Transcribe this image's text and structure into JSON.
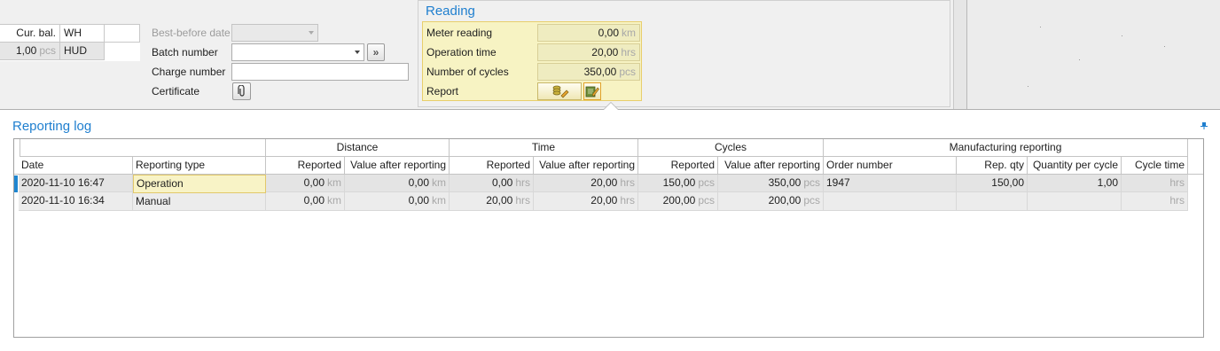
{
  "top_grid": {
    "headers": [
      "Cur. bal.",
      "WH"
    ],
    "row": {
      "cur_bal": "1,00",
      "cur_bal_unit": "pcs",
      "wh": "HUD"
    }
  },
  "form": {
    "best_before_label": "Best-before date",
    "batch_number_label": "Batch number",
    "charge_number_label": "Charge number",
    "certificate_label": "Certificate",
    "batch_number_value": "",
    "charge_number_value": ""
  },
  "reading": {
    "title": "Reading",
    "meter_label": "Meter reading",
    "meter_value": "0,00",
    "meter_unit": "km",
    "operation_label": "Operation time",
    "operation_value": "20,00",
    "operation_unit": "hrs",
    "cycles_label": "Number of cycles",
    "cycles_value": "350,00",
    "cycles_unit": "pcs",
    "report_label": "Report"
  },
  "log": {
    "title": "Reporting log",
    "bands": {
      "distance": "Distance",
      "time": "Time",
      "cycles": "Cycles",
      "manufacturing": "Manufacturing reporting"
    },
    "columns": {
      "date": "Date",
      "type": "Reporting type",
      "dist_rep": "Reported",
      "dist_after": "Value after reporting",
      "time_rep": "Reported",
      "time_after": "Value after reporting",
      "cyc_rep": "Reported",
      "cyc_after": "Value after reporting",
      "order": "Order number",
      "rep_qty": "Rep. qty",
      "qty_cycle": "Quantity per cycle",
      "cycle_time": "Cycle time"
    },
    "rows": [
      {
        "date": "2020-11-10 16:47",
        "type": "Operation",
        "dist_rep": "0,00",
        "dist_rep_u": "km",
        "dist_after": "0,00",
        "dist_after_u": "km",
        "time_rep": "0,00",
        "time_rep_u": "hrs",
        "time_after": "20,00",
        "time_after_u": "hrs",
        "cyc_rep": "150,00",
        "cyc_rep_u": "pcs",
        "cyc_after": "350,00",
        "cyc_after_u": "pcs",
        "order": "1947",
        "rep_qty": "150,00",
        "qty_cycle": "1,00",
        "cycle_time_u": "hrs"
      },
      {
        "date": "2020-11-10 16:34",
        "type": "Manual",
        "dist_rep": "0,00",
        "dist_rep_u": "km",
        "dist_after": "0,00",
        "dist_after_u": "km",
        "time_rep": "20,00",
        "time_rep_u": "hrs",
        "time_after": "20,00",
        "time_after_u": "hrs",
        "cyc_rep": "200,00",
        "cyc_rep_u": "pcs",
        "cyc_after": "200,00",
        "cyc_after_u": "pcs",
        "order": "",
        "rep_qty": "",
        "qty_cycle": "",
        "cycle_time_u": "hrs"
      }
    ]
  },
  "colors": {
    "accent": "#1f7fcf",
    "highlight": "#f7f3c3",
    "row_indicator": "#1f86d0"
  },
  "icons": [
    "forward-icon",
    "paperclip-icon",
    "coins-edit-icon",
    "report-edit-icon",
    "pin-icon"
  ]
}
